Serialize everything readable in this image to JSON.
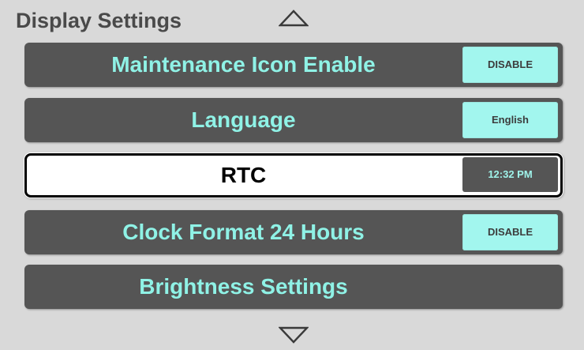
{
  "page": {
    "title": "Display Settings"
  },
  "navigation": {
    "up_icon": "triangle-up-outline",
    "down_icon": "triangle-down-outline"
  },
  "settings": [
    {
      "label": "Maintenance Icon Enable",
      "value": "DISABLE",
      "selected": false
    },
    {
      "label": "Language",
      "value": "English",
      "selected": false
    },
    {
      "label": "RTC",
      "value": "12:32 PM",
      "selected": true
    },
    {
      "label": "Clock Format 24 Hours",
      "value": "DISABLE",
      "selected": false
    },
    {
      "label": "Brightness Settings",
      "value": null,
      "selected": false
    }
  ],
  "colors": {
    "background": "#d9d9d9",
    "row_background": "#555555",
    "row_text": "#8ff2e6",
    "value_button_background": "#a2f6ee",
    "value_button_text": "#3c3c3c",
    "selected_row_background": "#ffffff",
    "selected_row_text": "#000000",
    "title_text": "#4a4a4a"
  }
}
